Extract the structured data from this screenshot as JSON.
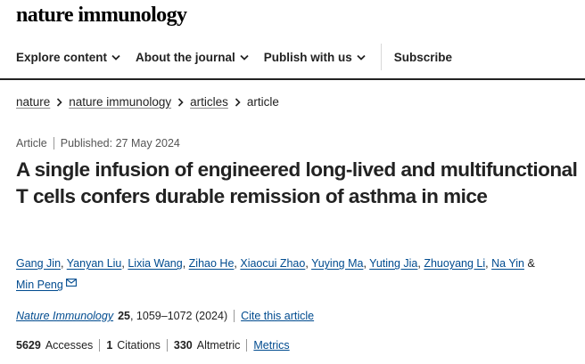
{
  "header": {
    "logo": "nature immunology"
  },
  "nav": {
    "items": [
      {
        "label": "Explore content",
        "dropdown": true
      },
      {
        "label": "About the journal",
        "dropdown": true
      },
      {
        "label": "Publish with us",
        "dropdown": true
      },
      {
        "label": "Subscribe",
        "dropdown": false
      }
    ]
  },
  "breadcrumb": [
    "nature",
    "nature immunology",
    "articles",
    "article"
  ],
  "article": {
    "type": "Article",
    "published": "Published: 27 May 2024",
    "title": "A single infusion of engineered long-lived and multifunctional T cells confers durable remission of asthma in mice",
    "authors": [
      "Gang Jin",
      "Yanyan Liu",
      "Lixia Wang",
      "Zihao He",
      "Xiaocui Zhao",
      "Yuying Ma",
      "Yuting Jia",
      "Zhuoyang Li",
      "Na Yin",
      "Min Peng"
    ],
    "author_join": "&",
    "journal": "Nature Immunology",
    "volume": "25",
    "pages_year": ", 1059–1072 (2024)",
    "cite_label": "Cite this article"
  },
  "metrics": {
    "accesses_value": "5629",
    "accesses_label": "Accesses",
    "citations_value": "1",
    "citations_label": "Citations",
    "altmetric_value": "330",
    "altmetric_label": "Altmetric",
    "metrics_link": "Metrics"
  },
  "colors": {
    "link": "#004b8f",
    "text": "#222222",
    "meta": "#555555"
  }
}
